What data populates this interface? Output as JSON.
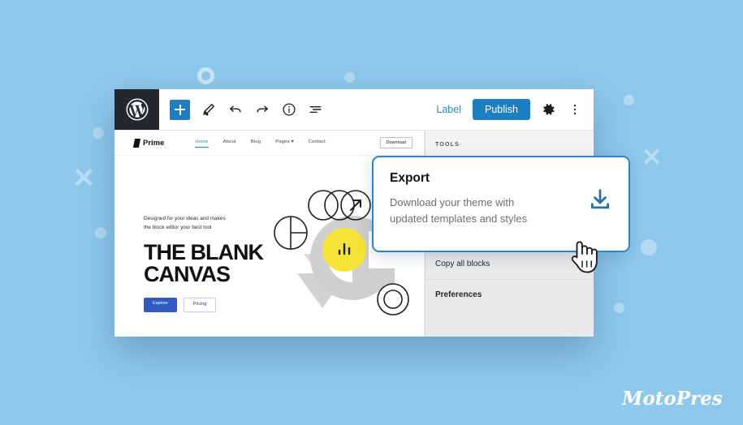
{
  "page": {
    "background_color": "#8ec8ec",
    "accent_color": "#1d7ec2"
  },
  "editor": {
    "logo_icon": "wordpress-icon",
    "toolbar_left": [
      {
        "icon": "add-block-icon",
        "label": "+"
      },
      {
        "icon": "edit-pencil-icon"
      },
      {
        "icon": "undo-icon"
      },
      {
        "icon": "redo-icon"
      },
      {
        "icon": "info-icon"
      },
      {
        "icon": "list-view-icon"
      }
    ],
    "toolbar_right": {
      "label_link": "Label",
      "publish_button": "Publish",
      "settings_icon": "gear-icon",
      "more_icon": "more-options-icon"
    }
  },
  "site_preview": {
    "brand": "Prime",
    "nav": [
      {
        "label": "Home",
        "active": true
      },
      {
        "label": "About",
        "active": false
      },
      {
        "label": "Blog",
        "active": false
      },
      {
        "label": "Pages ▾",
        "active": false
      },
      {
        "label": "Contact",
        "active": false
      }
    ],
    "download_button": "Download",
    "hero": {
      "subtitle_line1": "Designed for your ideas and makes",
      "subtitle_line2": "the block editor your best tool",
      "title_line1": "THE BLANK",
      "title_line2": "CANVAS",
      "primary_button": "Explore",
      "secondary_button": "Pricing",
      "art_icons": [
        "overlapping-circles-arrow-icon",
        "quartered-circle-icon",
        "yellow-bar-chart-icon",
        "ring-circle-icon"
      ]
    }
  },
  "tools_panel": {
    "heading": "TOOLS",
    "items": [
      {
        "label": "Copy all blocks",
        "strong": false
      },
      {
        "label": "Preferences",
        "strong": true
      }
    ]
  },
  "callout": {
    "title": "Export",
    "description_line1": "Download your theme with",
    "description_line2": "updated templates and styles",
    "icon": "download-icon",
    "border_color": "#2d86c4"
  },
  "cursor": {
    "icon": "pointing-hand-cursor"
  },
  "brand_logo": {
    "text": "MotoPress"
  }
}
